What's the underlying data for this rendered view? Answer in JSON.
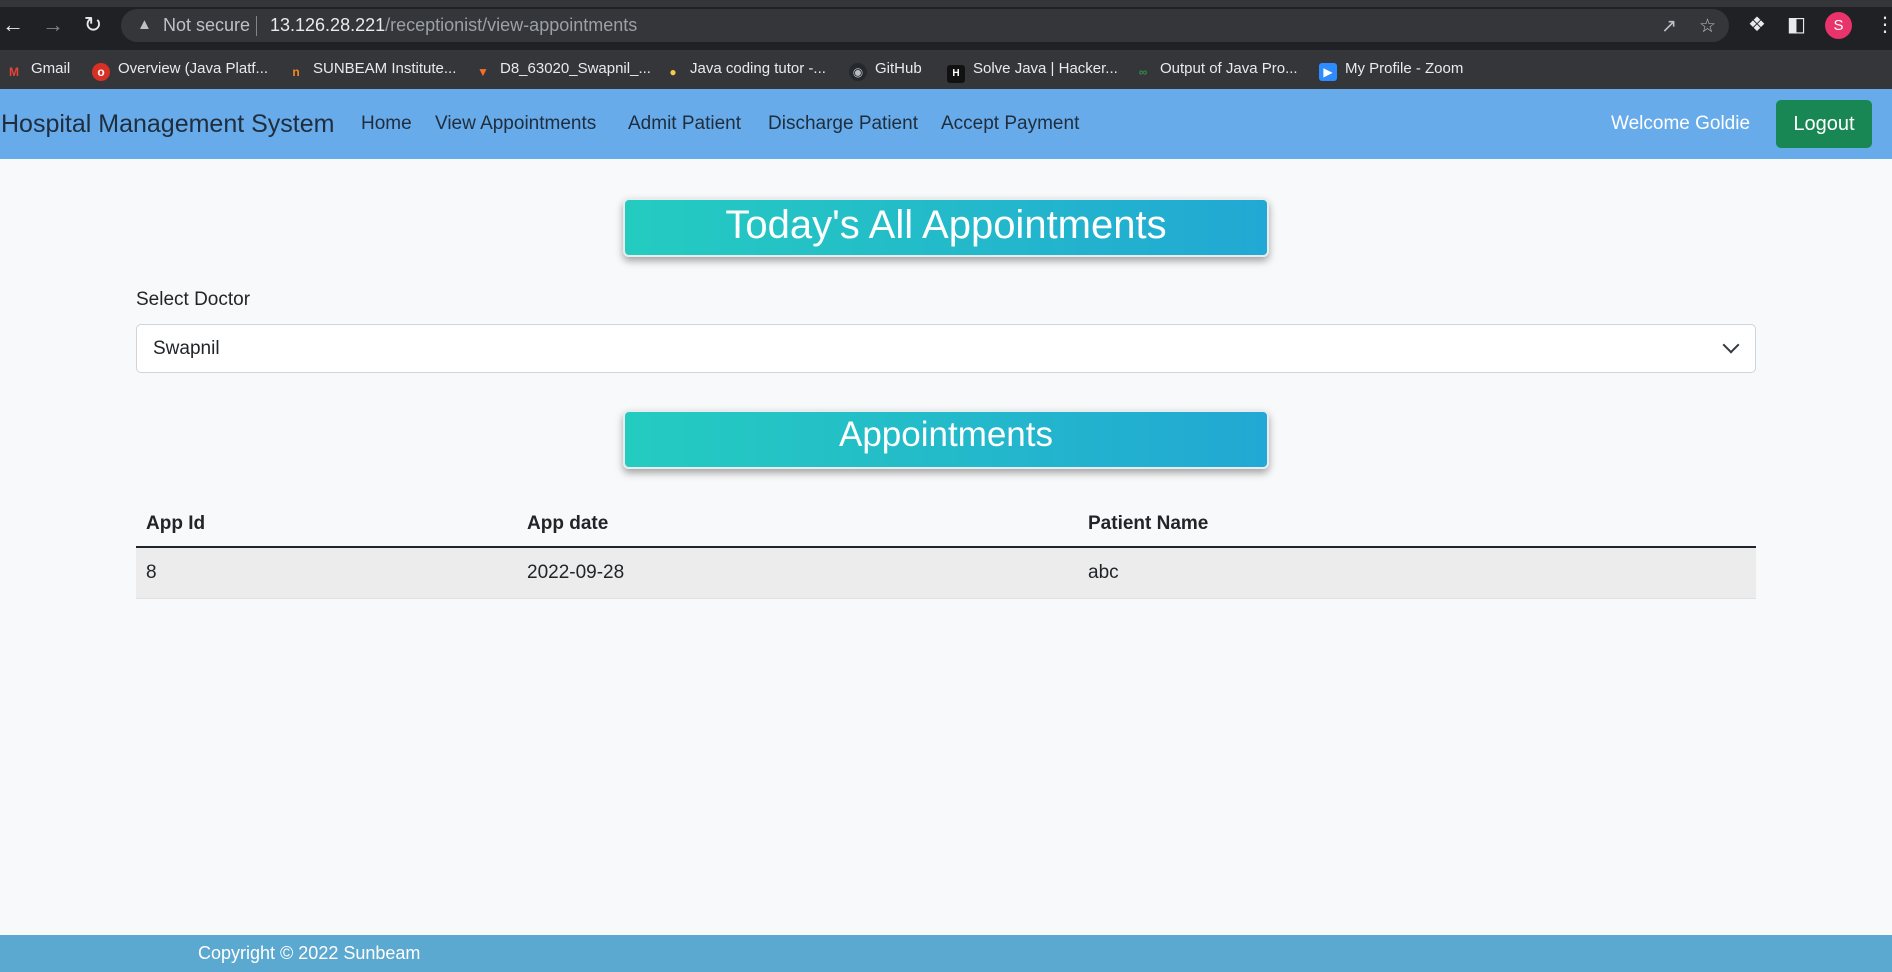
{
  "browser": {
    "security_label": "Not secure",
    "url_host": "13.126.28.221",
    "url_path": "/receptionist/view-appointments",
    "profile_initial": "S",
    "bookmarks": [
      {
        "label": "Gmail"
      },
      {
        "label": "Overview (Java Platf..."
      },
      {
        "label": "SUNBEAM Institute..."
      },
      {
        "label": "D8_63020_Swapnil_..."
      },
      {
        "label": "Java coding tutor -..."
      },
      {
        "label": "GitHub"
      },
      {
        "label": "Solve Java | Hacker..."
      },
      {
        "label": "Output of Java Pro..."
      },
      {
        "label": "My Profile - Zoom"
      }
    ]
  },
  "navbar": {
    "brand": "Hospital Management System",
    "links": [
      "Home",
      "View Appointments",
      "Admit Patient",
      "Discharge Patient",
      "Accept Payment"
    ],
    "welcome": "Welcome Goldie",
    "logout": "Logout",
    "background_color": "#67abea"
  },
  "main": {
    "title": "Today's All Appointments",
    "select_label": "Select Doctor",
    "selected_doctor": "Swapnil",
    "appointments_title": "Appointments",
    "table": {
      "headers": [
        "App Id",
        "App date",
        "Patient Name"
      ],
      "rows": [
        [
          "8",
          "2022-09-28",
          "abc"
        ]
      ]
    }
  },
  "footer": {
    "text": "Copyright © 2022 Sunbeam"
  }
}
